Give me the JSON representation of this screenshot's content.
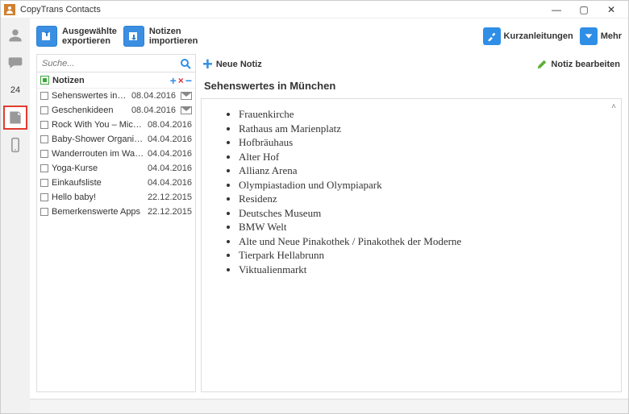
{
  "window": {
    "title": "CopyTrans Contacts",
    "min": "—",
    "max": "▢",
    "close": "✕"
  },
  "rail": {
    "calendar_text": "24"
  },
  "toolbar": {
    "export": {
      "line1": "Ausgewählte",
      "line2": "exportieren"
    },
    "import": {
      "line1": "Notizen",
      "line2": "importieren"
    },
    "guides": "Kurzanleitungen",
    "more": "Mehr"
  },
  "search": {
    "placeholder": "Suche..."
  },
  "list": {
    "header_label": "Notizen",
    "items": [
      {
        "label": "Sehenswertes in München",
        "date": "08.04.2016",
        "mail": true
      },
      {
        "label": "Geschenkideen",
        "date": "08.04.2016",
        "mail": true
      },
      {
        "label": "Rock With You – Michael ...",
        "date": "08.04.2016",
        "mail": false
      },
      {
        "label": "Baby-Shower Organisation",
        "date": "04.04.2016",
        "mail": false
      },
      {
        "label": "Wanderrouten im Wallis",
        "date": "04.04.2016",
        "mail": false
      },
      {
        "label": "Yoga-Kurse",
        "date": "04.04.2016",
        "mail": false
      },
      {
        "label": "Einkaufsliste",
        "date": "04.04.2016",
        "mail": false
      },
      {
        "label": "Hello baby!",
        "date": "22.12.2015",
        "mail": false
      },
      {
        "label": "Bemerkenswerte Apps",
        "date": "22.12.2015",
        "mail": false
      }
    ]
  },
  "detail": {
    "new_note": "Neue Notiz",
    "edit_note": "Notiz bearbeiten",
    "title": "Sehenswertes in München",
    "bullets": [
      "Frauenkirche",
      "Rathaus am Marienplatz",
      "Hofbräuhaus",
      "Alter Hof",
      "Allianz Arena",
      "Olympiastadion und Olympiapark",
      "Residenz",
      "Deutsches Museum",
      "BMW Welt",
      "Alte und Neue Pinakothek / Pinakothek der Moderne",
      "Tierpark Hellabrunn",
      "Viktualienmarkt"
    ]
  }
}
